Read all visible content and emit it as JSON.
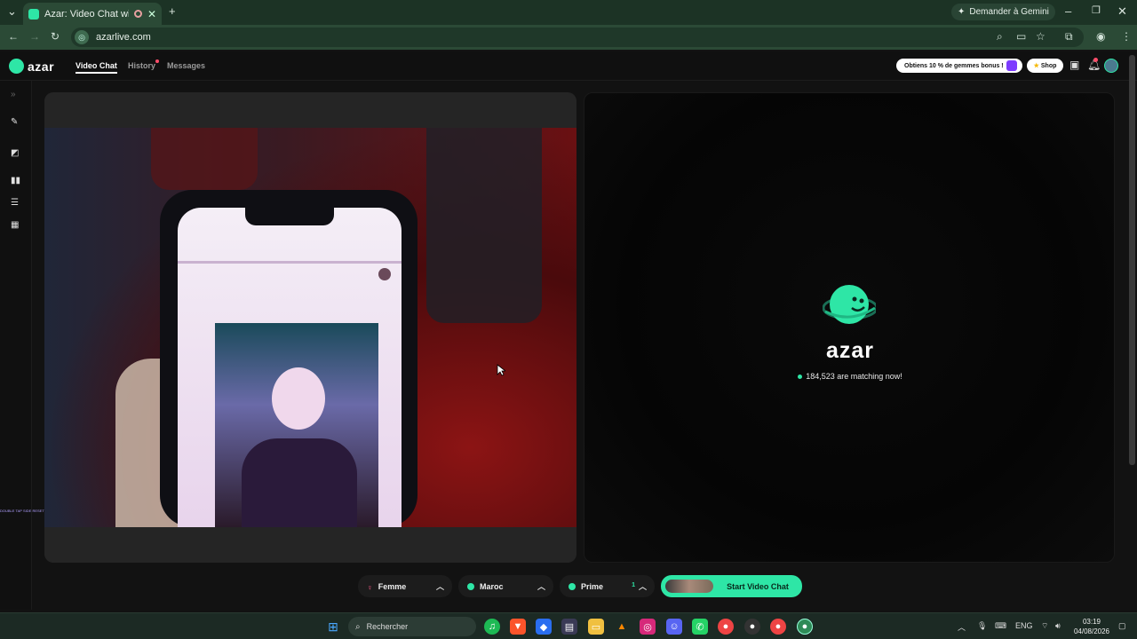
{
  "browser": {
    "tab_title": "Azar: Video Chat with New",
    "url": "azarlive.com",
    "gemini_label": "Demander à Gemini"
  },
  "app": {
    "logo_text": "azar",
    "nav": [
      {
        "label": "Video Chat",
        "active": true
      },
      {
        "label": "History",
        "active": false
      },
      {
        "label": "Messages",
        "active": false
      }
    ],
    "promo_text": "Obtiens 10 % de gemmes bonus !",
    "shop_label": "Shop"
  },
  "sidebar": {
    "overflow_text": "DOUBLE TAP SIDE RESET"
  },
  "match": {
    "brand": "azar",
    "matching_text": "184,523 are matching now!"
  },
  "controls": {
    "gender": "Femme",
    "region": "Maroc",
    "tier": "Prime",
    "tier_badge": "1",
    "start_label": "Start Video Chat"
  },
  "taskbar": {
    "search_placeholder": "Rechercher",
    "lang": "ENG",
    "time": "03:19",
    "date": "04/08/2026"
  },
  "colors": {
    "accent": "#2ee6a6",
    "browser_frame": "#2b4a36"
  }
}
